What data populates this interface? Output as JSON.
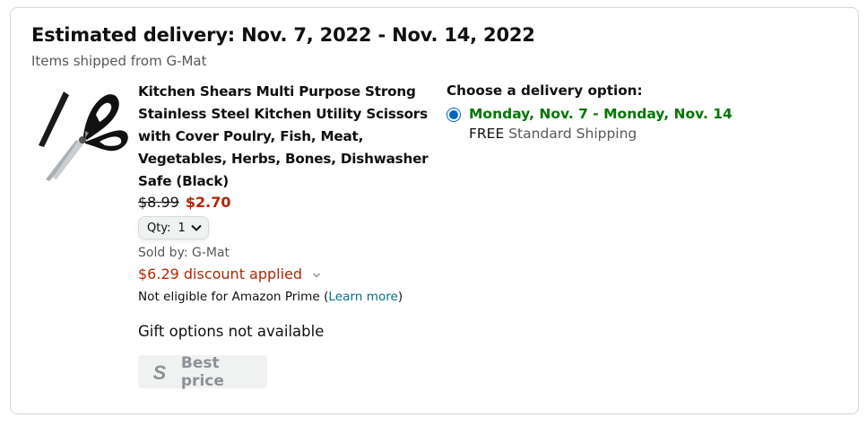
{
  "delivery": {
    "title": "Estimated delivery: Nov. 7, 2022 - Nov. 14, 2022",
    "shipped_from": "Items shipped from G-Mat"
  },
  "product": {
    "title": "Kitchen Shears Multi Purpose Strong\nStainless Steel Kitchen Utility Scissors\nwith Cover Poulry, Fish, Meat,\nVegetables, Herbs, Bones, Dishwasher\nSafe (Black)",
    "price_original": "$8.99",
    "price_current": "$2.70",
    "qty_label": "Qty:",
    "qty_value": "1",
    "sold_by": "Sold by: G-Mat",
    "discount": "$6.29 discount applied",
    "prime_text": "Not eligible for Amazon Prime (",
    "prime_link": "Learn more",
    "prime_close": ")",
    "gift": "Gift options not available",
    "best_price_label": "Best price",
    "image_icon": "kitchen-shears"
  },
  "delivery_options": {
    "title": "Choose a delivery option:",
    "options": [
      {
        "date": "Monday, Nov. 7 - Monday, Nov. 14",
        "cost": "FREE",
        "method": "Standard Shipping",
        "selected": true
      }
    ]
  },
  "colors": {
    "price_red": "#B12704",
    "date_green": "#007600",
    "link_teal": "#007185",
    "radio_blue": "#0066C0"
  }
}
